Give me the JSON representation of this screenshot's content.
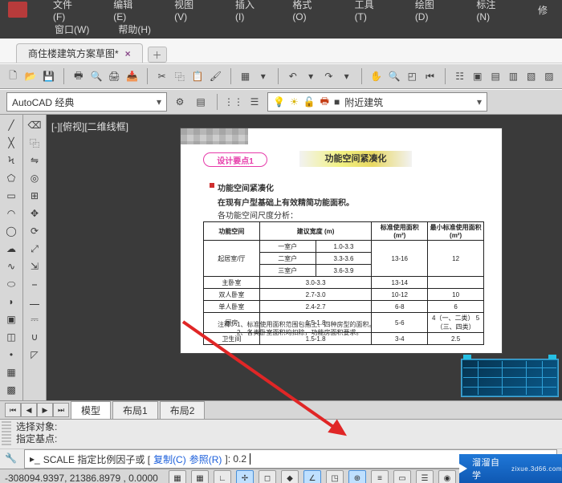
{
  "menu": {
    "file": "文件(F)",
    "edit": "编辑(E)",
    "view": "视图(V)",
    "insert": "插入(I)",
    "format": "格式(O)",
    "tools": "工具(T)",
    "draw": "绘图(D)",
    "dimension": "标注(N)",
    "modify": "修",
    "window": "窗口(W)",
    "help": "帮助(H)"
  },
  "filetab": {
    "name": "商住楼建筑方案草图*"
  },
  "workspace_combo": "AutoCAD 经典",
  "layer_combo": "附近建筑",
  "view_label": "[-][俯视][二维线框]",
  "page": {
    "badge": "设计要点1",
    "tag": "功能空间紧凑化",
    "sub1": "功能空间紧凑化",
    "sub2": "在现有户型基础上有效精简功能面积。",
    "sub3": "各功能空间尺度分析：",
    "cols": [
      "功能空间",
      "建议宽度 (m)",
      "标准使用面积 (m²)",
      "最小标准使用面积 (m²)"
    ],
    "rows": [
      [
        "起居室/厅",
        "一室户",
        "1.0-3.3",
        "",
        ""
      ],
      [
        "",
        "二室户",
        "3.3-3.6",
        "13-16",
        "12"
      ],
      [
        "",
        "三室户",
        "3.6-3.9",
        "",
        ""
      ],
      [
        "主卧室",
        "",
        "3.0-3.3",
        "13-14",
        ""
      ],
      [
        "双人卧室",
        "",
        "2.7-3.0",
        "10-12",
        "10"
      ],
      [
        "单人卧室",
        "",
        "2.4-2.7",
        "6-8",
        "6"
      ],
      [
        "厨房",
        "",
        "1.5-1.8",
        "5-6",
        "4（一、二类）\n5（三、四类）"
      ],
      [
        "卫生间",
        "",
        "1.5-1.8",
        "3-4",
        "2.5"
      ]
    ],
    "note1": "注释：1、标准使用面积范围包括上、四种房型的面积。",
    "note2": "　　　2、各类卧室面积均扣除，功能房面积要求。"
  },
  "layout_tabs": {
    "model": "模型",
    "layout1": "布局1",
    "layout2": "布局2"
  },
  "console": {
    "line1": "选择对象:",
    "line2": "指定基点:",
    "cmd_label": "SCALE 指定比例因子或 [",
    "opt1": "复制(C)",
    "opt2": "参照(R)",
    "tail": "]: 0.2"
  },
  "logo": {
    "brand": "溜溜自学",
    "url": "zixue.3d66.com"
  },
  "status": {
    "coords": "-308094.9397, 21386.8979 , 0.0000",
    "tab": "模型"
  }
}
